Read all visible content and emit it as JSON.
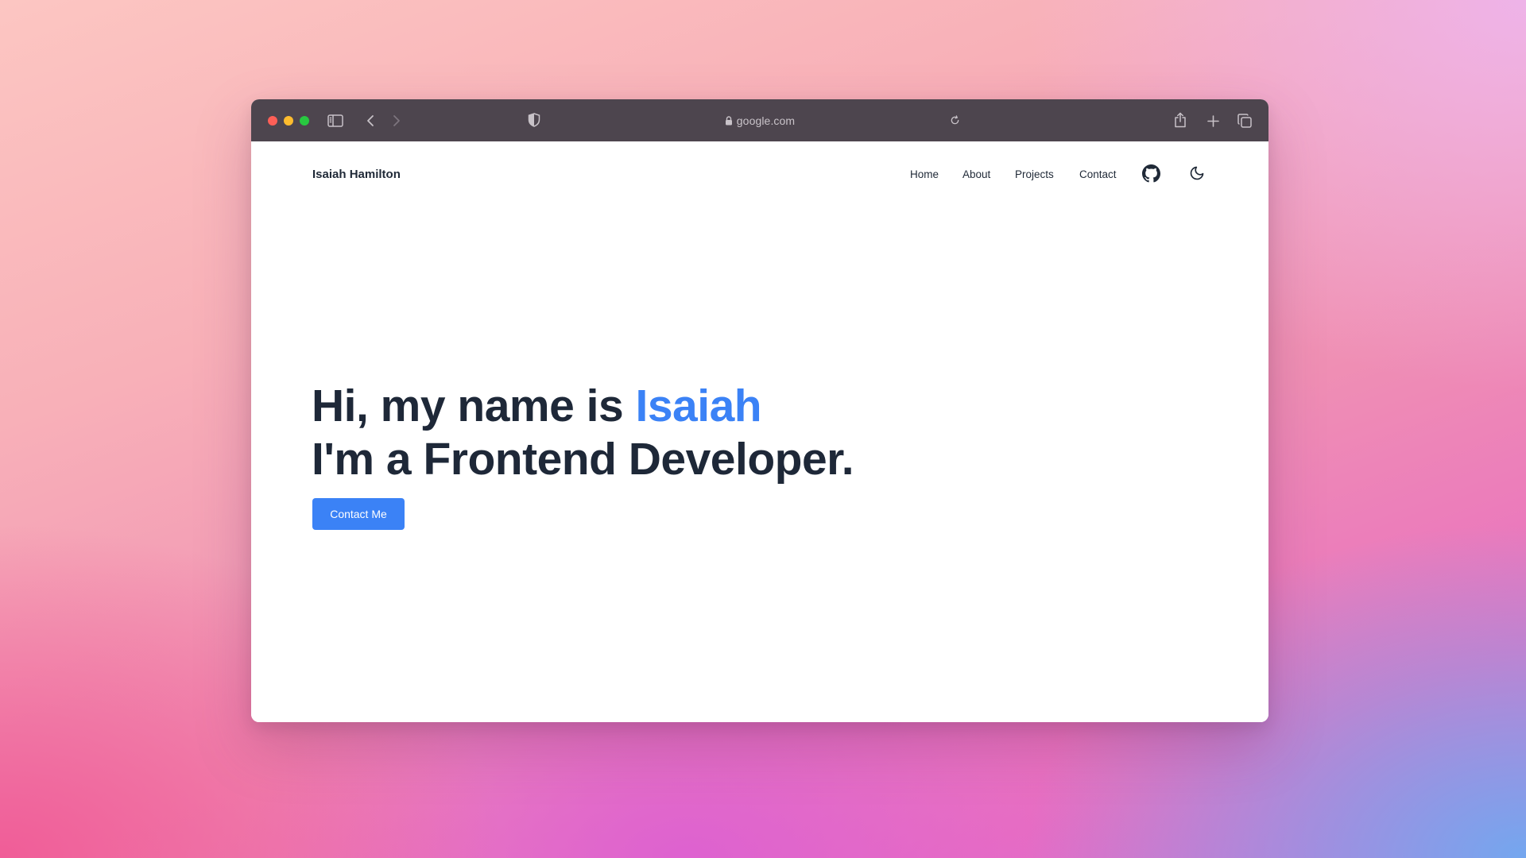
{
  "browser": {
    "url": "google.com",
    "icons": {
      "sidebar": "sidebar-icon",
      "back": "chevron-left-icon",
      "forward": "chevron-right-icon",
      "privacy": "shield-icon",
      "lock": "lock-icon",
      "reload": "reload-icon",
      "share": "share-icon",
      "new_tab": "plus-icon",
      "tabs": "tabs-overview-icon"
    },
    "colors": {
      "toolbar": "#4d454e",
      "close": "#fe5f57",
      "minimize": "#febc2e",
      "zoom": "#28c840"
    }
  },
  "site": {
    "brand": "Isaiah Hamilton",
    "nav": [
      {
        "label": "Home"
      },
      {
        "label": "About"
      },
      {
        "label": "Projects"
      },
      {
        "label": "Contact"
      }
    ],
    "nav_icons": [
      "github-icon",
      "moon-icon"
    ],
    "hero": {
      "line1_prefix": "Hi, my name is",
      "line1_name": "Isaiah",
      "line2": "I'm a Frontend Developer."
    },
    "cta_label": "Contact Me",
    "colors": {
      "accent": "#3b82f6",
      "text": "#1e2838",
      "background": "#ffffff"
    }
  }
}
